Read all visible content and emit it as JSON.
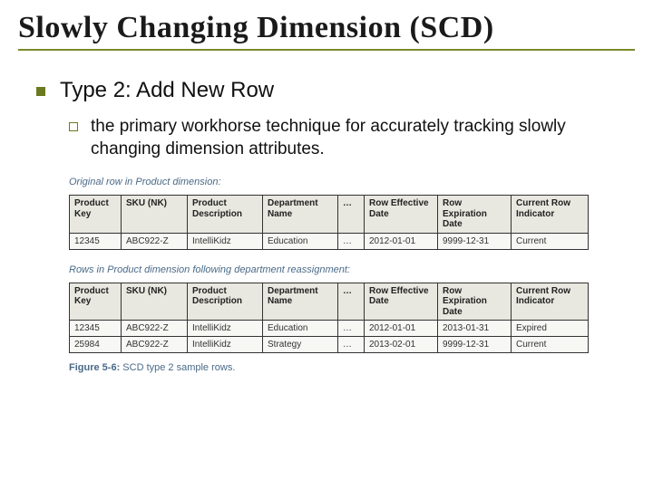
{
  "title": "Slowly Changing Dimension (SCD)",
  "type_heading": "Type 2: Add New Row",
  "sub_text": "the primary workhorse technique for accurately tracking slowly changing dimension attributes.",
  "caption1": "Original row in Product dimension:",
  "caption2": "Rows in Product dimension following department reassignment:",
  "headers": {
    "pkey": "Product Key",
    "sku": "SKU (NK)",
    "desc": "Product Description",
    "dept": "Department Name",
    "dots": "…",
    "eff": "Row Effective Date",
    "exp": "Row Expiration Date",
    "ind": "Current Row Indicator"
  },
  "table1": {
    "r0": {
      "pkey": "12345",
      "sku": "ABC922-Z",
      "desc": "IntelliKidz",
      "dept": "Education",
      "dots": "…",
      "eff": "2012-01-01",
      "exp": "9999-12-31",
      "ind": "Current"
    }
  },
  "table2": {
    "r0": {
      "pkey": "12345",
      "sku": "ABC922-Z",
      "desc": "IntelliKidz",
      "dept": "Education",
      "dots": "…",
      "eff": "2012-01-01",
      "exp": "2013-01-31",
      "ind": "Expired"
    },
    "r1": {
      "pkey": "25984",
      "sku": "ABC922-Z",
      "desc": "IntelliKidz",
      "dept": "Strategy",
      "dots": "…",
      "eff": "2013-02-01",
      "exp": "9999-12-31",
      "ind": "Current"
    }
  },
  "figure_label_bold": "Figure 5-6:",
  "figure_label_text": " SCD type 2 sample rows."
}
